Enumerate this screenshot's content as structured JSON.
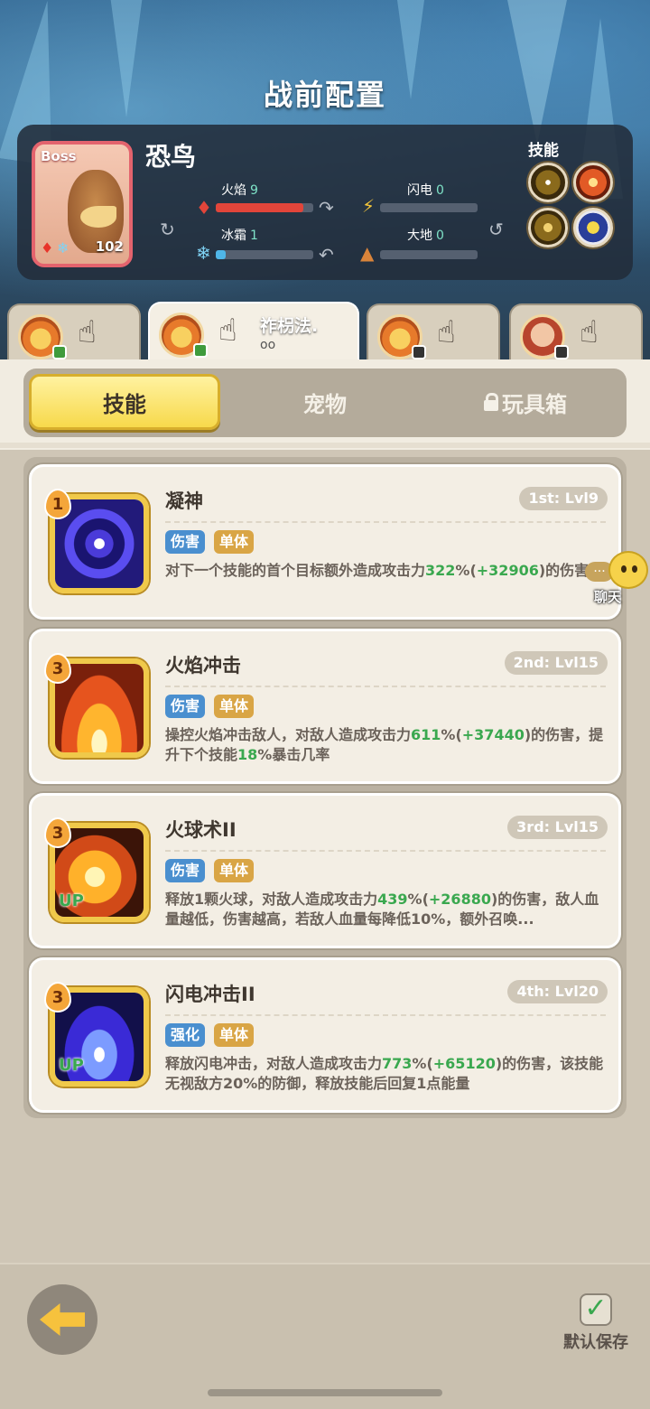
{
  "header": {
    "title": "战前配置"
  },
  "boss": {
    "tag": "Boss",
    "name": "恐鸟",
    "level": "102",
    "elements": [
      {
        "label": "火焰",
        "value": "9",
        "fill": 0.9,
        "color": "#e2453a"
      },
      {
        "label": "闪电",
        "value": "0",
        "fill": 0,
        "color": "#f2c53a"
      },
      {
        "label": "冰霜",
        "value": "1",
        "fill": 0.1,
        "color": "#4fb6e8"
      },
      {
        "label": "大地",
        "value": "0",
        "fill": 0,
        "color": "#d9843a"
      }
    ],
    "skills_label": "技能"
  },
  "loadouts": [
    {
      "name": "",
      "name2": ""
    },
    {
      "name": "祚枴法.",
      "name2": "oo"
    },
    {
      "name": "",
      "name2": ""
    },
    {
      "name": "",
      "name2": ""
    }
  ],
  "tabs": {
    "skills": "技能",
    "pets": "宠物",
    "toybox": "玩具箱"
  },
  "skills": [
    {
      "rank": "1",
      "name": "凝神",
      "slot": "1st: Lvl9",
      "tags": [
        "伤害",
        "单体"
      ],
      "desc_a": "对下一个技能的首个目标额外造成攻击力",
      "pct": "322",
      "pct_unit": "%(",
      "bonus": "+32906",
      "desc_b": ")的伤害"
    },
    {
      "rank": "3",
      "name": "火焰冲击",
      "slot": "2nd: Lvl15",
      "tags": [
        "伤害",
        "单体"
      ],
      "desc_a": "操控火焰冲击敌人，对敌人造成攻击力",
      "pct": "611",
      "pct_unit": "%(",
      "bonus": "+37440",
      "desc_b": ")的伤害，提升下个技能",
      "extra_green": "18",
      "desc_c": "%暴击几率"
    },
    {
      "rank": "3",
      "name": "火球术II",
      "slot": "3rd: Lvl15",
      "up": "UP",
      "tags": [
        "伤害",
        "单体"
      ],
      "desc_a": "释放1颗火球，对敌人造成攻击力",
      "pct": "439",
      "pct_unit": "%(",
      "bonus": "+26880",
      "desc_b": ")的伤害，敌人血量越低，伤害越高，若敌人血量每降低10%，额外召唤..."
    },
    {
      "rank": "3",
      "name": "闪电冲击II",
      "slot": "4th: Lvl20",
      "up": "UP",
      "tags": [
        "强化",
        "单体"
      ],
      "desc_a": "释放闪电冲击，对敌人造成攻击力",
      "pct": "773",
      "pct_unit": "%(",
      "bonus": "+65120",
      "desc_b": ")的伤害，该技能无视敌方20%的防御，释放技能后回复1点能量"
    }
  ],
  "chat": {
    "label": "聊天",
    "dots": "..."
  },
  "footer": {
    "save_label": "默认保存",
    "save_checked": true
  }
}
